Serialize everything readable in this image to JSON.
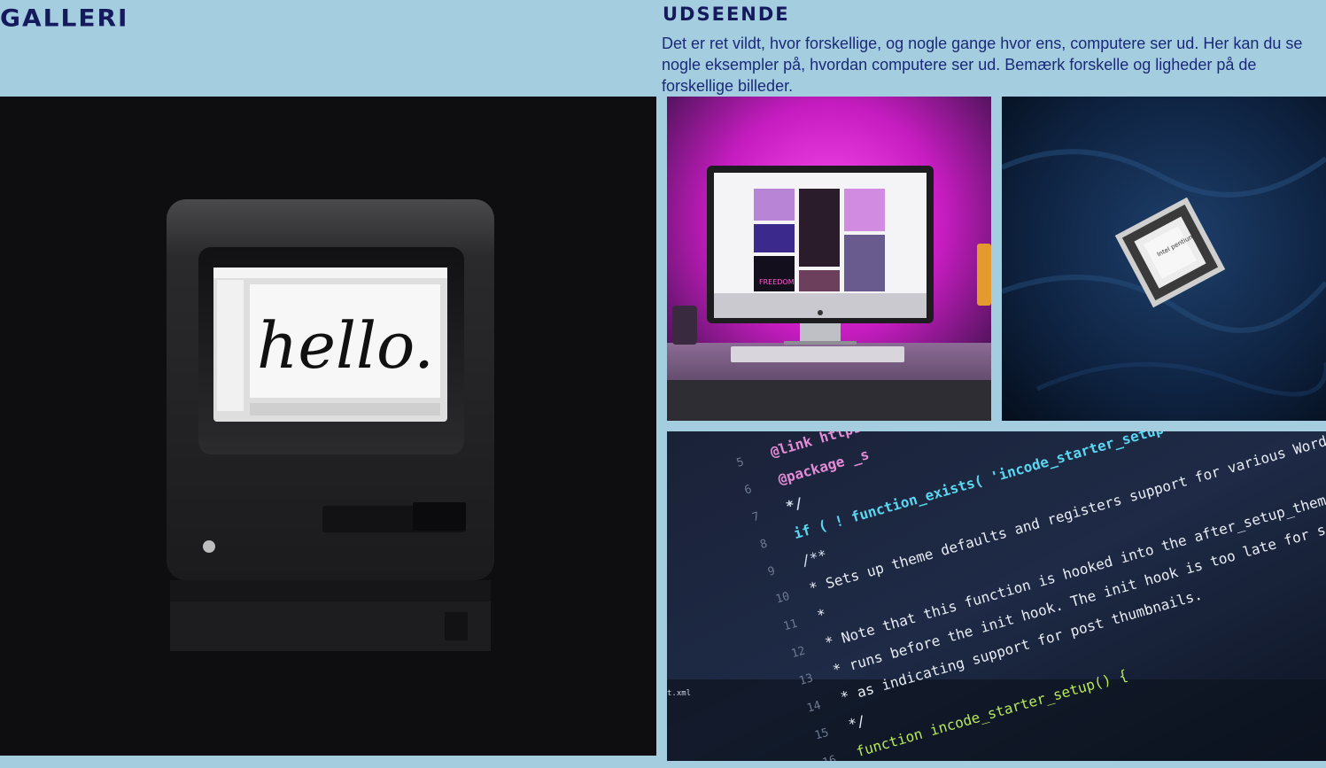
{
  "gallery": {
    "title": "GALLERI"
  },
  "udseende": {
    "title": "UDSEENDE",
    "text": "Det er ret vildt, hvor forskellige, og nogle gange hvor ens, computere ser ud. Her kan du se nogle eksempler på, hvordan computere ser ud. Bemærk forskelle og ligheder på de forskellige billeder."
  },
  "photos": {
    "mac": {
      "screen_text": "hello."
    },
    "imac": {
      "screen_text": "FREEDOM"
    },
    "cpu": {
      "chip_text": "Intel pentium"
    },
    "code": {
      "lines": [
        "@link https://deve",
        "@package _s",
        "*/",
        "if ( ! function_exists( 'incode_starter_setup' ) ) :",
        "/**",
        " * Sets up theme defaults and registers support for various WordPress fe",
        " *",
        " * Note that this function is hooked into the after_setup_theme hook, which",
        " * runs before the init hook. The init hook is too late for some features",
        " * as indicating support for post thumbnails.",
        " */",
        "function incode_starter_setup() {"
      ],
      "line_numbers": [
        "5",
        "6",
        "7",
        "8",
        "9",
        "10",
        "11",
        "12",
        "13",
        "14",
        "15",
        "16"
      ],
      "side_label": "t.xml"
    }
  },
  "colors": {
    "background": "#a5cde0",
    "heading": "#141a5c",
    "body_text": "#1a2a78"
  }
}
